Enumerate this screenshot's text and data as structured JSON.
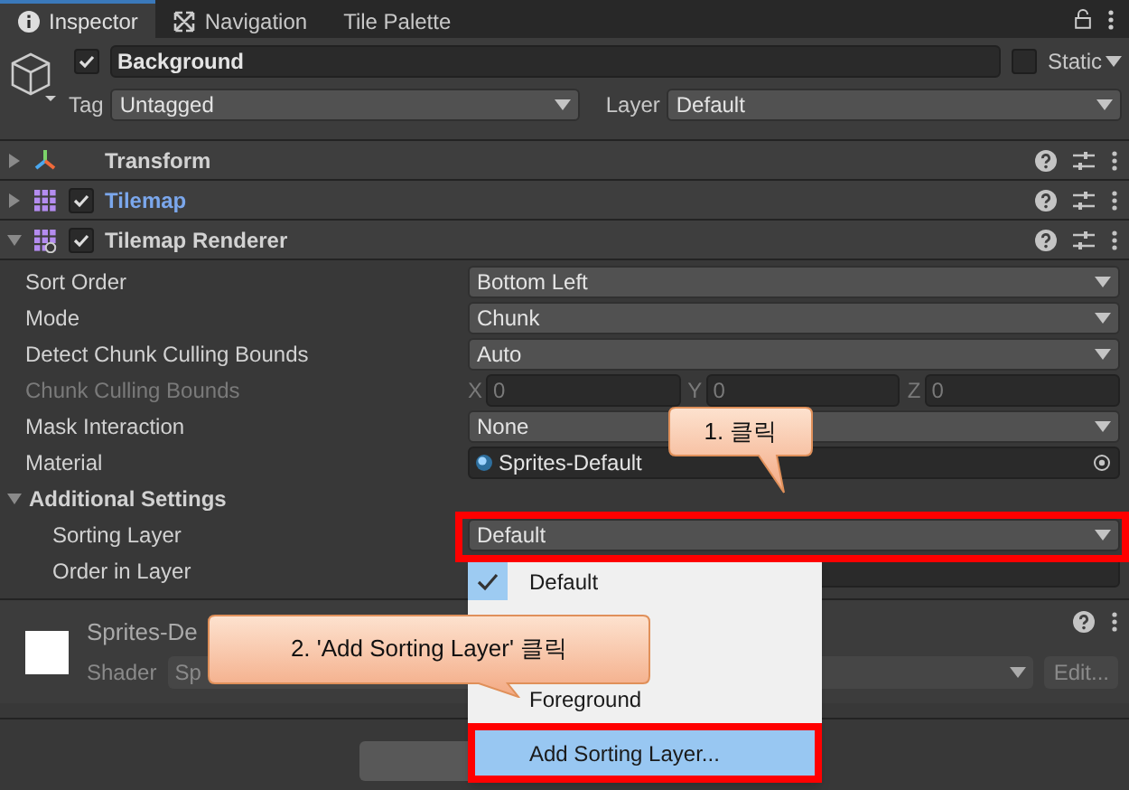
{
  "tabs": [
    {
      "label": "Inspector",
      "kind": "info",
      "selected": true
    },
    {
      "label": "Navigation",
      "kind": "nav",
      "selected": false
    },
    {
      "label": "Tile Palette",
      "kind": "none",
      "selected": false
    }
  ],
  "header": {
    "name": "Background",
    "active": true,
    "static_label": "Static",
    "static": false,
    "tag_label": "Tag",
    "tag_value": "Untagged",
    "layer_label": "Layer",
    "layer_value": "Default"
  },
  "components": [
    {
      "name": "Transform",
      "kind": "transform",
      "expanded": false,
      "modified": false
    },
    {
      "name": "Tilemap",
      "kind": "tilemap",
      "expanded": false,
      "checked": true,
      "modified": true
    },
    {
      "name": "Tilemap Renderer",
      "kind": "renderer",
      "expanded": true,
      "checked": true,
      "modified": false
    }
  ],
  "properties": [
    {
      "label": "Sort Order",
      "kind": "dropdown",
      "value": "Bottom Left",
      "disabled": false
    },
    {
      "label": "Mode",
      "kind": "dropdown",
      "value": "Chunk",
      "disabled": false
    },
    {
      "label": "Detect Chunk Culling Bounds",
      "kind": "dropdown",
      "value": "Auto",
      "disabled": false
    },
    {
      "label": "Chunk Culling Bounds",
      "kind": "vector3",
      "disabled": true,
      "axes": [
        {
          "axis": "X",
          "value": "0"
        },
        {
          "axis": "Y",
          "value": "0"
        },
        {
          "axis": "Z",
          "value": "0"
        }
      ]
    },
    {
      "label": "Mask Interaction",
      "kind": "dropdown",
      "value": "None",
      "disabled": false
    },
    {
      "label": "Material",
      "kind": "object",
      "value": "Sprites-Default",
      "disabled": false
    },
    {
      "label": "Additional Settings",
      "kind": "section",
      "expanded": true,
      "children": [
        {
          "label": "Sorting Layer",
          "kind": "dropdown",
          "value": "Default",
          "disabled": false
        },
        {
          "label": "Order in Layer",
          "kind": "number",
          "disabled": false
        }
      ]
    }
  ],
  "material": {
    "name": "Sprites-De",
    "shader_label": "Shader",
    "shader_value": "Sp",
    "edit_button": "Edit..."
  },
  "menu": {
    "items": [
      {
        "label": "Default",
        "selected": true
      },
      {
        "label": "Foreground",
        "selected": false
      }
    ],
    "action": "Add Sorting Layer..."
  },
  "callouts": [
    {
      "text": "1. 클릭"
    },
    {
      "text": "2. 'Add Sorting Layer' 클릭"
    }
  ]
}
